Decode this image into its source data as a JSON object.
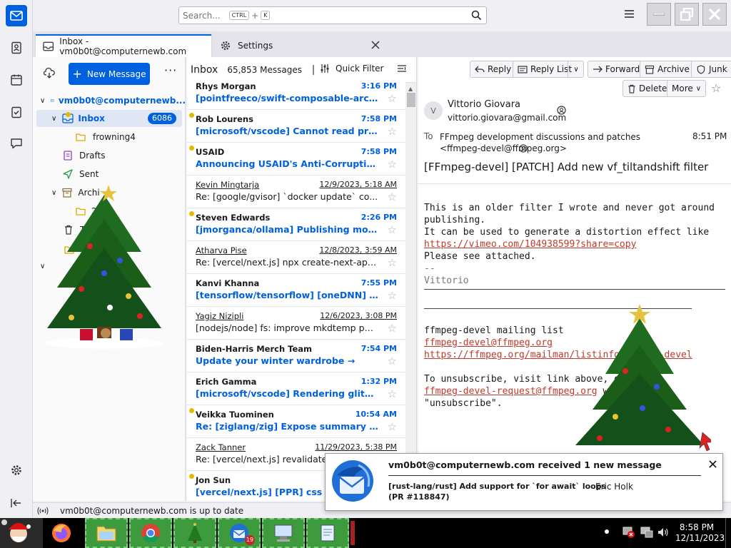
{
  "window": {
    "search_placeholder": "Search...",
    "search_key1": "CTRL",
    "search_plus": "+",
    "search_key2": "K"
  },
  "tabs": [
    {
      "label": "Inbox - vm0b0t@computernewb.com"
    },
    {
      "label": "Settings"
    }
  ],
  "folders": {
    "new_message": "New Message",
    "account": "vm0b0t@computernewb...",
    "inbox": "Inbox",
    "inbox_count": "6086",
    "subfolder": "frowning4",
    "drafts": "Drafts",
    "sent": "Sent",
    "archives": "Archi",
    "archive_year": "202",
    "trash": "Tr"
  },
  "threads": {
    "folder": "Inbox",
    "count": "65,853 Messages",
    "quick_filter": "Quick Filter",
    "items": [
      {
        "sender": "Rhys Morgan",
        "date": "3:16 PM",
        "subject": "[pointfreeco/swift-composable-archit...",
        "unread": true
      },
      {
        "sender": "Rob Lourens",
        "date": "7:58 PM",
        "subject": "[microsoft/vscode] Cannot read propert...",
        "unread": true
      },
      {
        "sender": "USAID",
        "date": "7:58 PM",
        "subject": "Announcing USAID's Anti-Corruption C...",
        "unread": true
      },
      {
        "sender": "Kevin Mingtarja",
        "date": "12/9/2023, 5:18 AM",
        "subject": "Re: [google/gvisor] `docker update` co...",
        "unread": false
      },
      {
        "sender": "Steven Edwards",
        "date": "2:26 PM",
        "subject": "[jmorganca/ollama] Publishing mod...",
        "unread": true
      },
      {
        "sender": "Atharva Pise",
        "date": "12/8/2023, 3:59 AM",
        "subject": "Re: [vercel/next.js] npx create-next-app f...",
        "unread": false
      },
      {
        "sender": "Kanvi Khanna",
        "date": "7:55 PM",
        "subject": "[tensorflow/tensorflow] [oneDNN] Add...",
        "unread": true
      },
      {
        "sender": "Yagiz Nizipli",
        "date": "12/6/2023, 3:08 PM",
        "subject": "[nodejs/node] fs: improve mkdtemp per...",
        "unread": false
      },
      {
        "sender": "Biden-Harris Merch Team",
        "date": "7:54 PM",
        "subject": "Update your winter wardrobe →",
        "unread": true
      },
      {
        "sender": "Erich Gamma",
        "date": "1:32 PM",
        "subject": "[microsoft/vscode] Rendering glitch ...",
        "unread": true
      },
      {
        "sender": "Veikka Tuominen",
        "date": "10:54 AM",
        "subject": "Re: [ziglang/zig] Expose summary to ...",
        "unread": true
      },
      {
        "sender": "Zack Tanner",
        "date": "11/29/2023, 5:38 PM",
        "subject": "Re: [vercel/next.js] revalidate",
        "unread": false
      },
      {
        "sender": "Jon Sun",
        "date": "",
        "subject": "[vercel/next.js] [PPR] css ar",
        "unread": true
      }
    ]
  },
  "message": {
    "toolbar": {
      "reply": "Reply",
      "reply_list": "Reply List",
      "forward": "Forward",
      "archive": "Archive",
      "junk": "Junk",
      "delete": "Delete",
      "more": "More"
    },
    "avatar_letter": "V",
    "from_name": "Vittorio Giovara",
    "from_email": "vittorio.giovara@gmail.com",
    "to_label": "To",
    "to_value": "FFmpeg development discussions and patches <ffmpeg-devel@ffmpeg.org>",
    "time": "8:51 PM",
    "subject": "[FFmpeg-devel] [PATCH] Add new vf_tiltandshift filter",
    "body_line1": "This is an older filter I wrote and never got around",
    "body_line2": "publishing.",
    "body_line3": "It can be used to generate a distortion effect like",
    "body_link1": "https://vimeo.com/104938599?share=copy",
    "body_line4": "Please see attached.",
    "sig_sep": "--",
    "sig_name": "Vittorio",
    "list_name": "ffmpeg-devel mailing list",
    "list_email": "ffmpeg-devel@ffmpeg.org",
    "list_url": "https://ffmpeg.org/mailman/listinfo/ffmpeg-devel",
    "unsub_line": "To unsubscribe, visit link above, or email",
    "unsub_email": "ffmpeg-devel-request@ffmpeg.org",
    "unsub_tail": " with subject",
    "unsub_word": "\"unsubscribe\"."
  },
  "status": {
    "text": "vm0b0t@computernewb.com is up to date"
  },
  "notification": {
    "title": "vm0b0t@computernewb.com received 1 new message",
    "subject_line1": "[rust-lang/rust] Add support for `for await` loops",
    "subject_line2": "(PR #118847)",
    "sender": "Eric Holk"
  },
  "taskbar": {
    "time": "8:58 PM",
    "date": "12/11/2023",
    "badge_count": "19"
  },
  "colors": {
    "accent": "#0061e0",
    "unread_dot": "#e6b800",
    "link": "#c0392b",
    "taskbar_app": "#3d9a3d"
  }
}
